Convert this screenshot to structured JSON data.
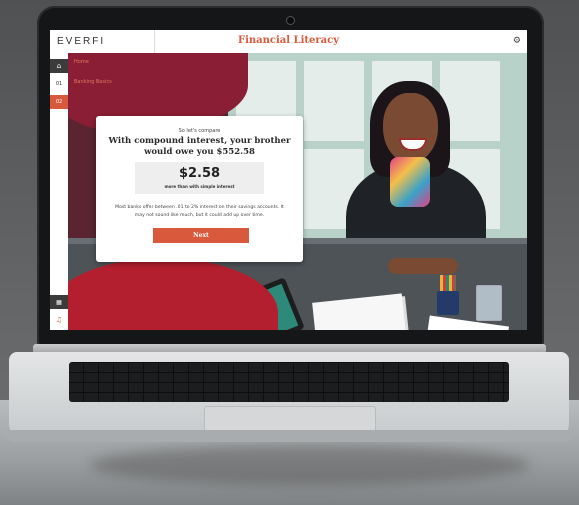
{
  "app": {
    "logo": "EVERFI",
    "title": "Financial Literacy",
    "settings_icon": "gear-icon"
  },
  "nav": {
    "home_icon": "home-icon",
    "items": [
      "01",
      "02"
    ],
    "bottom_icons": [
      "calculator-icon",
      "music-icon"
    ]
  },
  "breadcrumb": {
    "parent": "Home",
    "current": "Banking Basics"
  },
  "card": {
    "kicker": "So let's compare",
    "headline": "With compound interest, your brother would owe you $552.58",
    "amount": "$2.58",
    "amount_caption": "more than with simple interest",
    "body": "Most banks offer between .01 to 2% interest on their savings accounts. It may not sound like much, but it could add up over time.",
    "button": "Next"
  },
  "colors": {
    "accent": "#d9593c",
    "maroon": "#5a2531",
    "nav_dark": "#3b3b3b"
  }
}
